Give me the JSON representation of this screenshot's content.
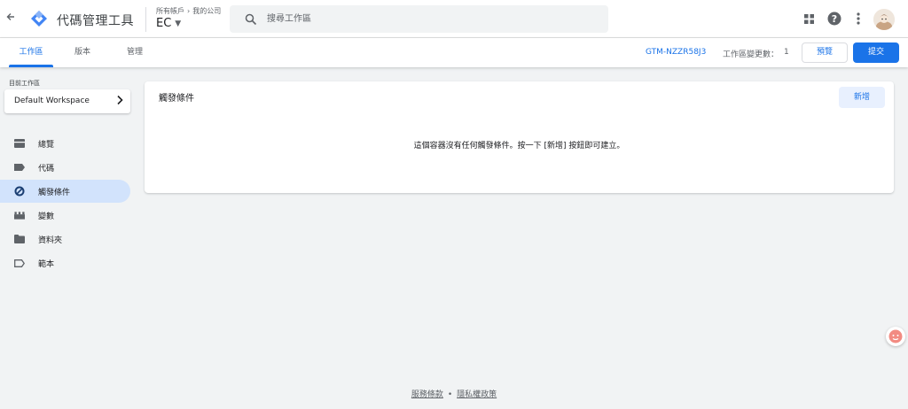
{
  "header": {
    "app_title": "代碼管理工具",
    "breadcrumb": {
      "account": "所有帳戶",
      "separator": "›",
      "company": "我的公司"
    },
    "container": "EC",
    "search_placeholder": "搜尋工作區",
    "icons": [
      "back-arrow-icon",
      "gtm-logo-icon",
      "search-icon",
      "apps-grid-icon",
      "help-icon",
      "more-vert-icon"
    ]
  },
  "tabs": [
    {
      "label": "工作區",
      "active": true
    },
    {
      "label": "版本",
      "active": false
    },
    {
      "label": "管理",
      "active": false
    }
  ],
  "tabbar": {
    "container_id": "GTM-NZZR58J3",
    "changes_label": "工作區變更數：",
    "changes_count": "1",
    "preview_label": "預覽",
    "submit_label": "提交"
  },
  "sidebar": {
    "workspace_label": "目前工作區",
    "workspace_name": "Default Workspace",
    "items": [
      {
        "label": "總覽",
        "icon": "overview-icon",
        "active": false
      },
      {
        "label": "代碼",
        "icon": "tag-icon",
        "active": false
      },
      {
        "label": "觸發條件",
        "icon": "trigger-icon",
        "active": true
      },
      {
        "label": "變數",
        "icon": "variable-icon",
        "active": false
      },
      {
        "label": "資料夾",
        "icon": "folder-icon",
        "active": false
      },
      {
        "label": "範本",
        "icon": "template-icon",
        "active": false
      }
    ]
  },
  "main": {
    "title": "觸發條件",
    "new_button": "新增",
    "empty_message": "這個容器沒有任何觸發條件。按一下 [新增] 按鈕即可建立。"
  },
  "footer": {
    "terms": "服務條款",
    "separator": "•",
    "privacy": "隱私權政策"
  },
  "colors": {
    "accent": "#1a73e8",
    "active_nav_bg": "#d2e3fc",
    "page_bg": "#f1f3f4"
  }
}
